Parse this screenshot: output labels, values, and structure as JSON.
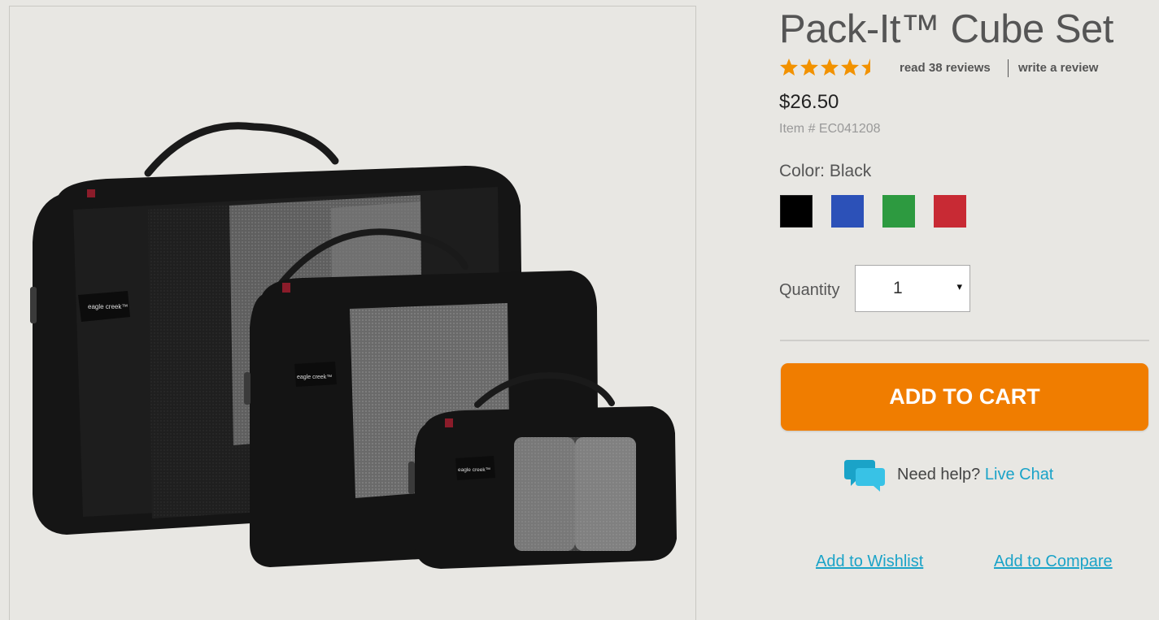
{
  "product": {
    "title": "Pack-It™ Cube Set",
    "rating": 4.5,
    "read_reviews": "read 38 reviews",
    "write_review": "write a review",
    "price": "$26.50",
    "item_number": "Item # EC041208",
    "brand_logo_text": "eagle creek™"
  },
  "color": {
    "label": "Color:",
    "selected": "Black",
    "swatches": [
      {
        "name": "Black",
        "hex": "#000000"
      },
      {
        "name": "Blue",
        "hex": "#2c51b8"
      },
      {
        "name": "Green",
        "hex": "#2d9a40"
      },
      {
        "name": "Red",
        "hex": "#c82a34"
      }
    ]
  },
  "quantity": {
    "label": "Quantity",
    "value": "1",
    "arrow": "▾"
  },
  "actions": {
    "add_to_cart": "ADD TO CART",
    "need_help": "Need help?",
    "live_chat": "Live Chat",
    "add_to_wishlist": "Add to Wishlist",
    "add_to_compare": "Add to Compare"
  },
  "colors": {
    "accent_orange": "#f07d00",
    "link_blue": "#1aa3c8",
    "background": "#e8e7e3",
    "star": "#f29200"
  },
  "icons": [
    "star-icon",
    "chat-bubble-icon",
    "dropdown-arrow-icon"
  ]
}
